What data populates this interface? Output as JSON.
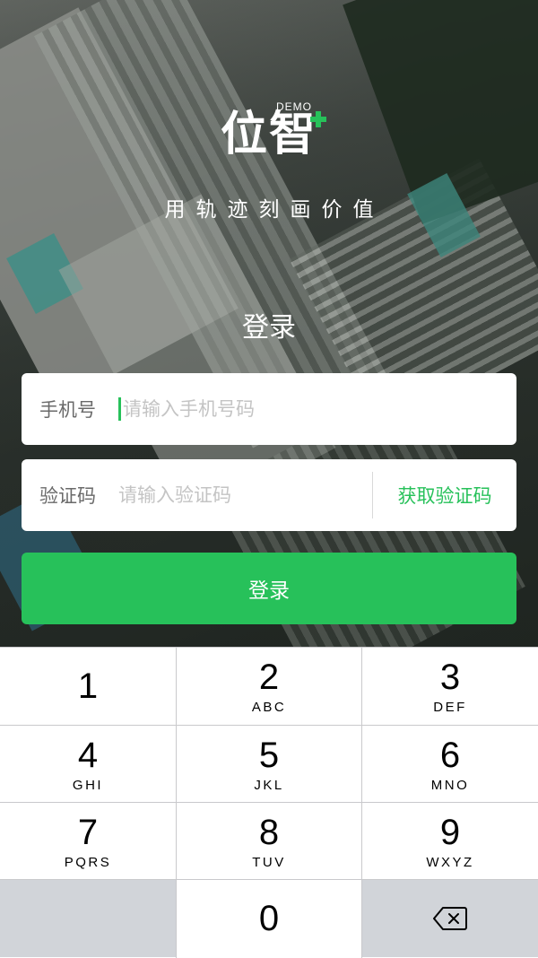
{
  "brand": {
    "logo_text": "位智",
    "logo_badge": "DEMO",
    "slogan": "用轨迹刻画价值",
    "accent_color": "#27c15a"
  },
  "login": {
    "title": "登录",
    "phone": {
      "label": "手机号",
      "placeholder": "请输入手机号码",
      "value": ""
    },
    "code": {
      "label": "验证码",
      "placeholder": "请输入验证码",
      "value": "",
      "get_code_label": "获取验证码"
    },
    "submit_label": "登录"
  },
  "keypad": {
    "keys": [
      {
        "digit": "1",
        "letters": ""
      },
      {
        "digit": "2",
        "letters": "ABC"
      },
      {
        "digit": "3",
        "letters": "DEF"
      },
      {
        "digit": "4",
        "letters": "GHI"
      },
      {
        "digit": "5",
        "letters": "JKL"
      },
      {
        "digit": "6",
        "letters": "MNO"
      },
      {
        "digit": "7",
        "letters": "PQRS"
      },
      {
        "digit": "8",
        "letters": "TUV"
      },
      {
        "digit": "9",
        "letters": "WXYZ"
      },
      {
        "digit": "0",
        "letters": ""
      }
    ],
    "backspace_icon": "backspace-icon"
  }
}
